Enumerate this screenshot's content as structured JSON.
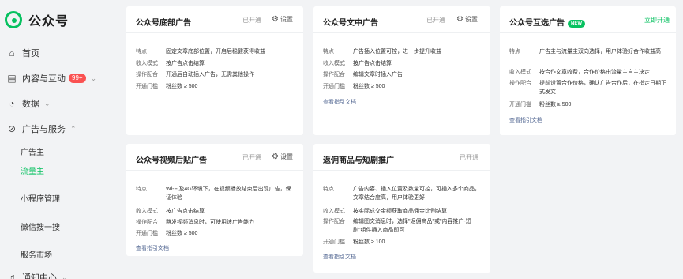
{
  "brand": {
    "name": "公众号",
    "logo_icon": "wechat-oa-logo"
  },
  "colors": {
    "accent": "#07c160",
    "badge": "#fa5151",
    "link": "#576b95"
  },
  "nav": {
    "home": "首页",
    "content": "内容与互动",
    "content_badge": "99+",
    "data": "数据",
    "ads": "广告与服务",
    "ads_sub": [
      "广告主",
      "流量主"
    ],
    "miniprogram": "小程序管理",
    "wxsearch": "微信搜一搜",
    "market": "服务市场",
    "notify": "通知中心"
  },
  "cards": [
    {
      "title": "公众号底部广告",
      "status": "已开通",
      "settings": "设置",
      "rows": [
        {
          "k": "特点",
          "v": "固定文章底部位置，开启后稳健获得收益"
        },
        {
          "k": "收入模式",
          "v": "按广告点击结算"
        },
        {
          "k": "操作配合",
          "v": "开通后自动插入广告，无需其他操作"
        },
        {
          "k": "开通门槛",
          "v": "粉丝数 ≥ 500"
        }
      ]
    },
    {
      "title": "公众号文中广告",
      "status": "已开通",
      "settings": "设置",
      "rows": [
        {
          "k": "特点",
          "v": "广告插入位置可控，进一步提升收益"
        },
        {
          "k": "收入模式",
          "v": "按广告点击结算"
        },
        {
          "k": "操作配合",
          "v": "编辑文章时插入广告"
        },
        {
          "k": "开通门槛",
          "v": "粉丝数 ≥ 500"
        }
      ],
      "link": "查看指引文档"
    },
    {
      "title": "公众号互选广告",
      "new_badge": "NEW",
      "status": "立即开通",
      "rows": [
        {
          "k": "特点",
          "v": "广告主与流量主双向选择，用户体验好合作收益高"
        },
        {
          "k": "收入模式",
          "v": "按合作文章收费，合作价格由流量主自主决定"
        },
        {
          "k": "操作配合",
          "v": "提前设置合作价格，确认广告合作后，在指定日期正式发文"
        },
        {
          "k": "开通门槛",
          "v": "粉丝数 ≥ 500"
        }
      ],
      "link": "查看指引文档"
    },
    {
      "title": "公众号视频后贴广告",
      "status": "已开通",
      "settings": "设置",
      "rows": [
        {
          "k": "特点",
          "v": "Wi-Fi及4G环境下，在视频播放结束后出现广告，保证体验"
        },
        {
          "k": "收入模式",
          "v": "按广告点击结算"
        },
        {
          "k": "操作配合",
          "v": "群发视频消息时，可使用该广告能力"
        },
        {
          "k": "开通门槛",
          "v": "粉丝数 ≥ 500"
        }
      ],
      "link": "查看指引文档"
    },
    {
      "title": "返佣商品与短剧推广",
      "status": "已开通",
      "rows": [
        {
          "k": "特点",
          "v": "广告内容、插入位置及数量可控，可插入多个商品，文章结合度高，用户体验更好"
        },
        {
          "k": "收入模式",
          "v": "按实际成交金额获取商品佣金比例结算"
        },
        {
          "k": "操作配合",
          "v": "编辑图文消息时，选择\"返佣商品\"或\"内容推广-短剧\"组件插入商品即可"
        },
        {
          "k": "开通门槛",
          "v": "粉丝数 ≥ 100"
        }
      ],
      "link": "查看指引文档"
    }
  ]
}
